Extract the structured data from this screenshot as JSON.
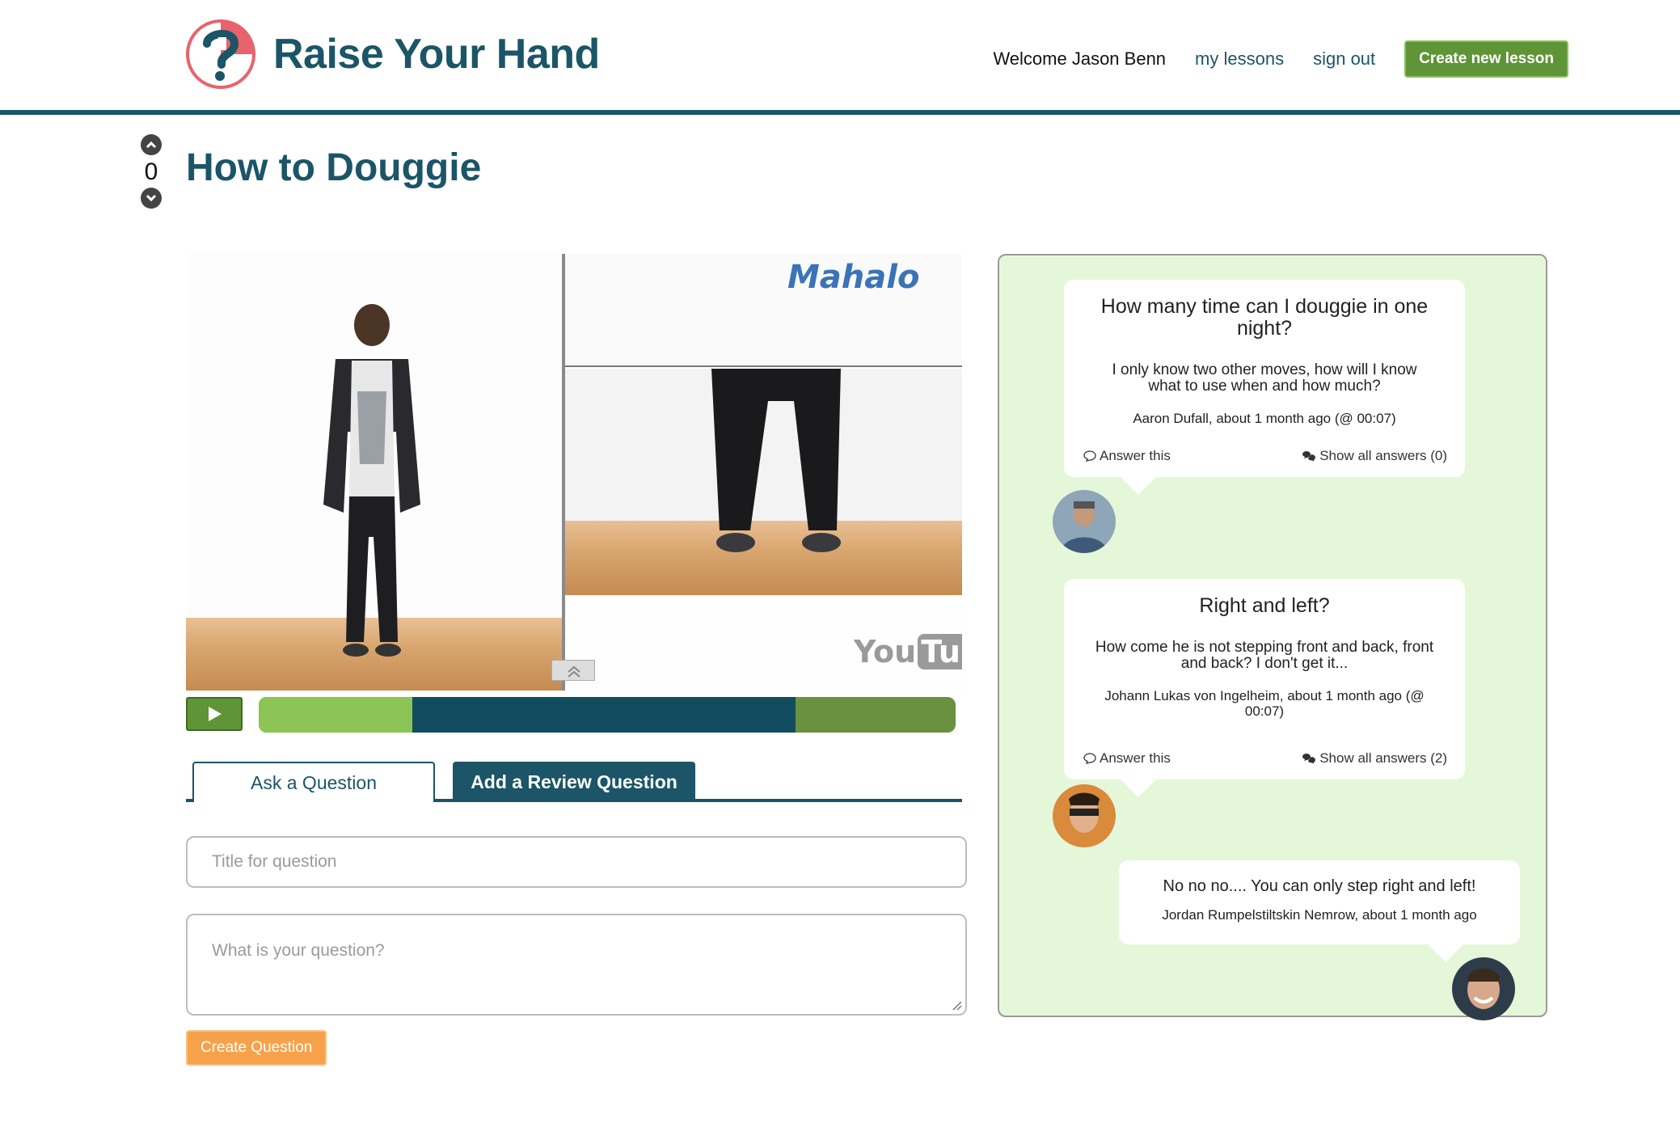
{
  "header": {
    "app_name": "Raise Your Hand",
    "welcome": "Welcome Jason Benn",
    "my_lessons": "my lessons",
    "sign_out": "sign out",
    "create_lesson": "Create new lesson"
  },
  "lesson": {
    "title": "How to Douggie",
    "votes": "0"
  },
  "video": {
    "watermark_brand": "Mahalo",
    "watermark_player_you": "You",
    "watermark_player_tube": "Tube",
    "played_fraction": 0.22,
    "buffered_fraction": 0.77
  },
  "tabs": {
    "ask": "Ask a Question",
    "review": "Add a Review Question"
  },
  "form": {
    "title_placeholder": "Title for question",
    "body_placeholder": "What is your question?",
    "submit": "Create Question"
  },
  "questions": [
    {
      "title": "How many time can I douggie in one night?",
      "body": "I only know two other moves, how will I know what to use when and how much?",
      "meta": "Aaron Dufall, about 1 month ago (@ 00:07)",
      "answer": "Answer this",
      "show_answers": "Show all answers (0)"
    },
    {
      "title": "Right and left?",
      "body": "How come he is not stepping front and back, front and back? I don't get it...",
      "meta": "Johann Lukas von Ingelheim, about 1 month ago (@ 00:07)",
      "answer": "Answer this",
      "show_answers": "Show all answers (2)"
    }
  ],
  "answers": [
    {
      "text": "No no no.... You can only step right and left!",
      "meta": "Jordan Rumpelstiltskin Nemrow, about 1 month ago"
    }
  ],
  "colors": {
    "brand": "#1b5567",
    "green": "#5f9437",
    "orange": "#f7a24a",
    "panel_bg": "#e5f7d9"
  }
}
